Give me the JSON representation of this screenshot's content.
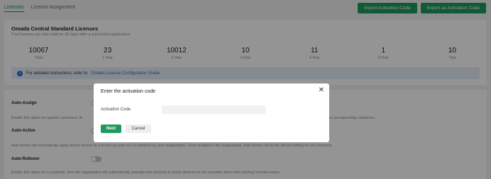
{
  "tabs": [
    {
      "label": "Licenses",
      "active": true
    },
    {
      "label": "License Assignment",
      "active": false
    }
  ],
  "top_actions": {
    "import_label": "Import Activation Code",
    "export_label": "Export as Activation Code"
  },
  "licenses_card": {
    "title": "Omada Central Standard Licenses",
    "subtitle": "Trial licenses are only valid for 30 days after a successful application.",
    "stats": [
      {
        "value": "10067",
        "label": "Total"
      },
      {
        "value": "23",
        "label": "1-Year"
      },
      {
        "value": "10012",
        "label": "2-Year"
      },
      {
        "value": "10",
        "label": "3-Year"
      },
      {
        "value": "11",
        "label": "4-Year"
      },
      {
        "value": "1",
        "label": "5-Year"
      },
      {
        "value": "10",
        "label": "Trial"
      }
    ],
    "info_text": "For detailed instructions, refer to",
    "info_link": "Omada License Configuration Guide"
  },
  "settings": {
    "auto_assign": {
      "title": "Auto-Assign",
      "desc_left": "Enable this option for specific customers, th",
      "desc_right": "the corresponding customers."
    },
    "auto_active": {
      "title": "Auto-Active",
      "desc": "Auto-Active will automatically apply device license to a device as soon as it is adopted by your organization. Once enabled in the organization, Auto-Active will be the default setting for all customers."
    },
    "auto_rollover": {
      "title": "Auto-Rollover",
      "desc": "Enable this option for a customer, then the organization will automatically reassign new licenses to active devices on the customer when their existing licenses expire."
    }
  },
  "modal": {
    "title": "Enter the activation code",
    "field_label": "Activation Code",
    "field_value": "",
    "field_placeholder": "",
    "next_label": "Next",
    "cancel_label": "Cancel"
  },
  "colors": {
    "accent": "#1f9a5c",
    "info_bg": "#e6eef8",
    "link": "#2a6fd0"
  },
  "icons": {
    "close": "close-icon",
    "info": "info-icon"
  }
}
